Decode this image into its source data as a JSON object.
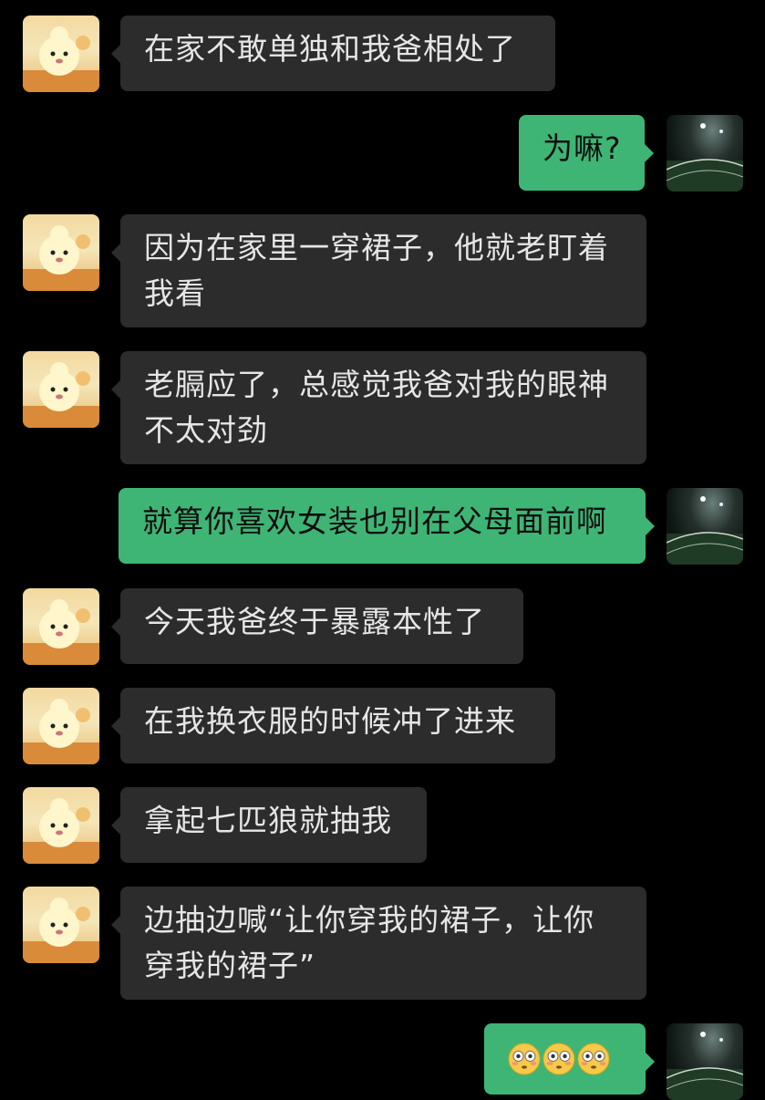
{
  "colors": {
    "background": "#000000",
    "incoming_bubble": "#2c2c2c",
    "outgoing_bubble": "#3eb575",
    "incoming_text": "#e6e6e6",
    "outgoing_text": "#0d0d0d"
  },
  "messages": [
    {
      "from": "other",
      "avatar_icon": "cartoon-bear-avatar-icon",
      "lines": [
        "在家不敢单独和我爸相处了"
      ]
    },
    {
      "from": "self",
      "avatar_icon": "night-field-avatar-icon",
      "lines": [
        "为嘛?"
      ]
    },
    {
      "from": "other",
      "avatar_icon": "cartoon-bear-avatar-icon",
      "lines": [
        "因为在家里一穿裙子，他就老盯着",
        "我看"
      ]
    },
    {
      "from": "other",
      "avatar_icon": "cartoon-bear-avatar-icon",
      "lines": [
        "老膈应了，总感觉我爸对我的眼神",
        "不太对劲"
      ]
    },
    {
      "from": "self",
      "avatar_icon": "night-field-avatar-icon",
      "lines": [
        "就算你喜欢女装也别在父母面前啊"
      ]
    },
    {
      "from": "other",
      "avatar_icon": "cartoon-bear-avatar-icon",
      "lines": [
        "今天我爸终于暴露本性了"
      ]
    },
    {
      "from": "other",
      "avatar_icon": "cartoon-bear-avatar-icon",
      "lines": [
        "在我换衣服的时候冲了进来"
      ]
    },
    {
      "from": "other",
      "avatar_icon": "cartoon-bear-avatar-icon",
      "lines": [
        "拿起七匹狼就抽我"
      ]
    },
    {
      "from": "other",
      "avatar_icon": "cartoon-bear-avatar-icon",
      "lines": [
        "边抽边喊“让你穿我的裙子，让你",
        "穿我的裙子”"
      ]
    },
    {
      "from": "self",
      "avatar_icon": "night-field-avatar-icon",
      "emoji": [
        "flushed-face-icon",
        "flushed-face-icon",
        "flushed-face-icon"
      ]
    }
  ]
}
